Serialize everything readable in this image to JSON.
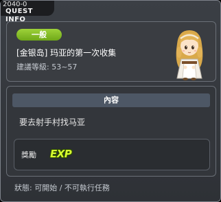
{
  "window": {
    "quest_id": "2040-0",
    "title": "QUEST INFO"
  },
  "quest": {
    "category": "一般",
    "name": "[金银岛] 玛亚的第一次收集",
    "level_requirement": "建議等級: 53~57"
  },
  "content": {
    "header": "內容",
    "description": "要去射手村找马亚"
  },
  "reward": {
    "label": "獎勵",
    "icon": "exp-icon",
    "icon_text": "EXP"
  },
  "status": {
    "text": "狀態: 可開始 / 不可執行任務"
  },
  "colors": {
    "category_badge": "#8cc42c",
    "exp_text": "#d8ff30",
    "panel_bg": "#3a3d42",
    "header_bar": "#4d5765"
  }
}
